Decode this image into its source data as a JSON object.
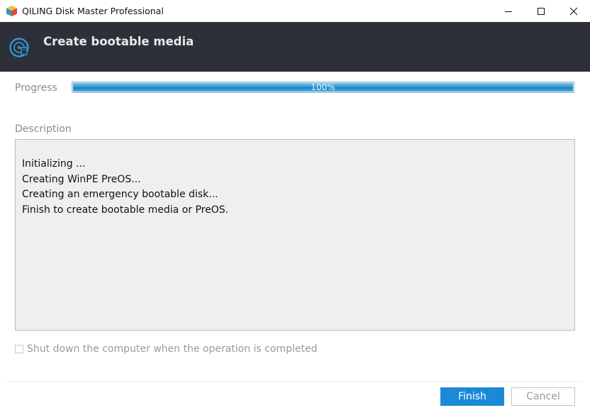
{
  "window": {
    "title": "QILING Disk Master Professional",
    "icons": {
      "app": "cube-app-icon",
      "minimize": "minimize-icon",
      "maximize": "maximize-icon",
      "close": "close-icon"
    }
  },
  "header": {
    "title": "Create bootable media",
    "icon": "bootable-media-icon"
  },
  "progress": {
    "label": "Progress",
    "percent": 100,
    "percent_text": "100%"
  },
  "description": {
    "label": "Description",
    "lines": [
      "Initializing ...",
      "Creating WinPE PreOS...",
      "Creating an emergency bootable disk...",
      "Finish to create bootable media or PreOS."
    ]
  },
  "options": {
    "shutdown_label": "Shut down the computer when the operation is completed",
    "shutdown_checked": false
  },
  "buttons": {
    "finish_label": "Finish",
    "cancel_label": "Cancel"
  },
  "colors": {
    "header_bg": "#2d3038",
    "accent": "#1a8ad8",
    "progress_fill": "#2d9ad6"
  }
}
